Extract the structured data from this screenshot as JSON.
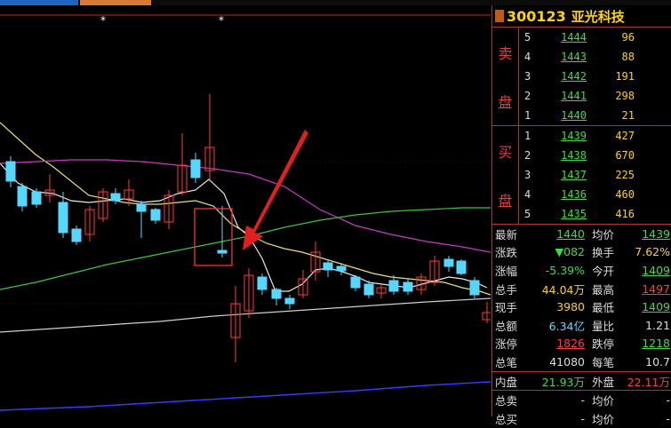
{
  "top_bar": {
    "colors": [
      "#1f63c4",
      "#d97a30",
      "#2b2b2b"
    ]
  },
  "chart": {
    "markers": [
      "*",
      "*"
    ]
  },
  "stock": {
    "code": "300123",
    "name": "亚光科技"
  },
  "sell_side_label": [
    "卖",
    "盘"
  ],
  "buy_side_label": [
    "买",
    "盘"
  ],
  "sell_book": [
    {
      "level": "5",
      "price": "1444",
      "volume": "96"
    },
    {
      "level": "4",
      "price": "1443",
      "volume": "88"
    },
    {
      "level": "3",
      "price": "1442",
      "volume": "191"
    },
    {
      "level": "2",
      "price": "1441",
      "volume": "298"
    },
    {
      "level": "1",
      "price": "1440",
      "volume": "21"
    }
  ],
  "buy_book": [
    {
      "level": "1",
      "price": "1439",
      "volume": "427"
    },
    {
      "level": "2",
      "price": "1438",
      "volume": "670"
    },
    {
      "level": "3",
      "price": "1437",
      "volume": "225"
    },
    {
      "level": "4",
      "price": "1436",
      "volume": "460"
    },
    {
      "level": "5",
      "price": "1435",
      "volume": "416"
    }
  ],
  "stats": [
    {
      "l1": "最新",
      "v1": "1440",
      "l2": "均价",
      "v2": "1439"
    },
    {
      "l1": "涨跌",
      "v1": "▼082",
      "l2": "换手",
      "v2": "7.62%"
    },
    {
      "l1": "涨幅",
      "v1": "-5.39%",
      "l2": "今开",
      "v2": "1409"
    },
    {
      "l1": "总手",
      "v1": "44.04万",
      "l2": "最高",
      "v2": "1497"
    },
    {
      "l1": "现手",
      "v1": "3980",
      "l2": "最低",
      "v2": "1409"
    },
    {
      "l1": "总额",
      "v1": "6.34亿",
      "l2": "量比",
      "v2": "1.21"
    },
    {
      "l1": "涨停",
      "v1": "1826",
      "l2": "跌停",
      "v2": "1218"
    },
    {
      "l1": "总笔",
      "v1": "41080",
      "l2": "每笔",
      "v2": "10.7"
    },
    {
      "l1": "内盘",
      "v1": "21.93万",
      "l2": "外盘",
      "v2": "22.11万"
    },
    {
      "l1": "总卖",
      "v1": "-",
      "l2": "均价",
      "v2": "-"
    },
    {
      "l1": "总买",
      "v1": "-",
      "l2": "均价",
      "v2": "-"
    }
  ]
}
